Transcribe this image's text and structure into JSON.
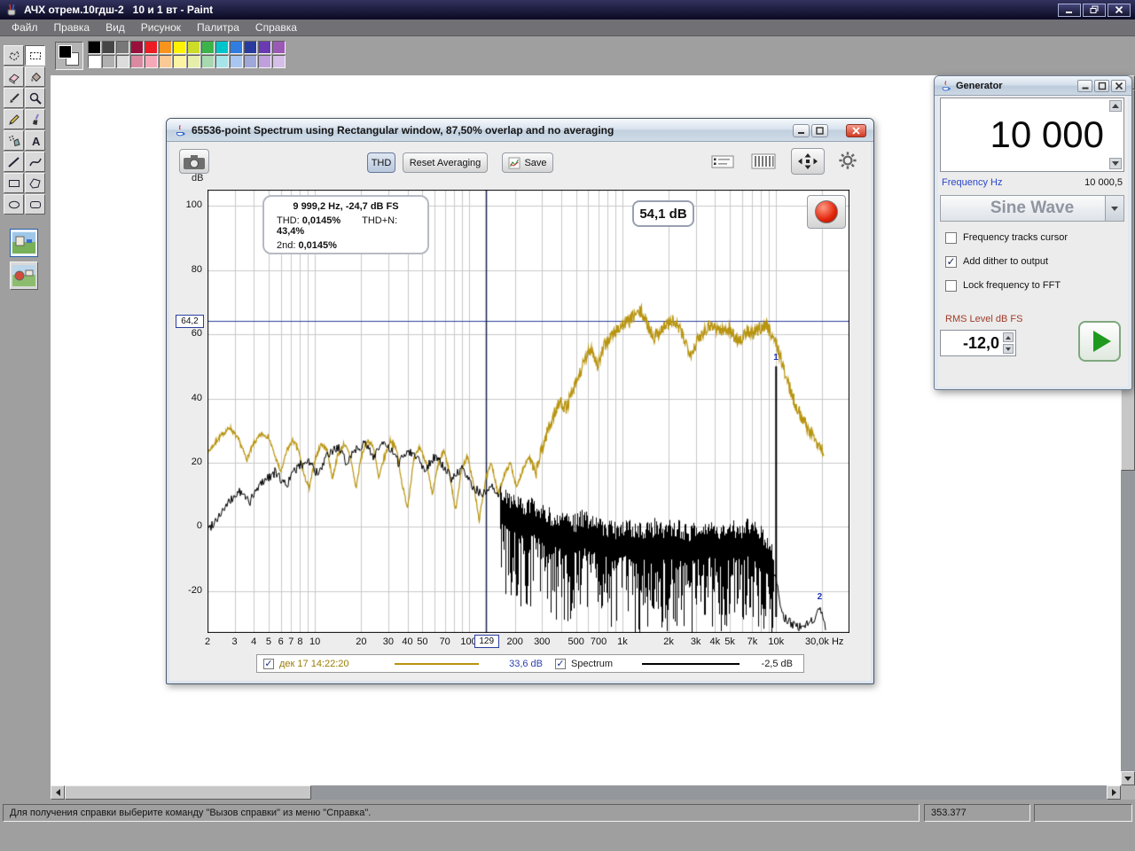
{
  "paint": {
    "title": "АЧХ отрем.10гдш-2   10 и 1 вт - Paint",
    "menu": [
      "Файл",
      "Правка",
      "Вид",
      "Рисунок",
      "Палитра",
      "Справка"
    ],
    "tools": [
      "free-select",
      "rect-select",
      "eraser",
      "fill",
      "color-picker",
      "magnifier",
      "pencil",
      "brush",
      "airbrush",
      "text",
      "line",
      "curve",
      "rectangle",
      "polygon",
      "ellipse",
      "rounded-rectangle"
    ],
    "selected_tool": "rect-select",
    "palette_row1": [
      "#000000",
      "#464646",
      "#787878",
      "#98103c",
      "#ed1c24",
      "#f7941d",
      "#fff200",
      "#cddc29",
      "#3cb44a",
      "#00c4cc",
      "#2f7de0",
      "#2a3b9e",
      "#6a3ab2",
      "#9b59b6"
    ],
    "palette_row2": [
      "#ffffff",
      "#b0b0b0",
      "#dcdcdc",
      "#d98aa0",
      "#f5a9b8",
      "#fbc993",
      "#fdf4a3",
      "#e6eeaa",
      "#a8d8b0",
      "#a5e5ea",
      "#a9c6f0",
      "#9fa8d8",
      "#bfa0dd",
      "#d5bfe8"
    ],
    "status": {
      "help_text": "Для получения справки выберите команду \"Вызов справки\" из меню \"Справка\".",
      "coords": "353.377"
    }
  },
  "rta": {
    "title": "65536-point Spectrum using Rectangular window, 87,50% overlap and no averaging",
    "toolbar": {
      "thd_label": "THD",
      "reset_label": "Reset Averaging",
      "save_label": "Save"
    },
    "db_label": "dB",
    "cursor_readout": {
      "line1": "9 999,2 Hz, -24,7 dB FS",
      "thd_label": "THD:",
      "thd": "0,0145%",
      "thdn_label": "THD+N:",
      "thdn": "43,4%",
      "h2_label": "2nd:",
      "h2": "0,0145%"
    },
    "level_display": "54,1 dB",
    "cursor_x": "129",
    "cursor_y": "64,2",
    "marker1": "1",
    "marker2": "2",
    "legend": [
      {
        "checked": true,
        "label": "дек 17 14:22:20",
        "value": "33,6 dB",
        "color": "#b8940f",
        "label_color": "#9a7d00",
        "value_color": "#2a3fb0"
      },
      {
        "checked": true,
        "label": "Spectrum",
        "value": "-2,5 dB",
        "color": "#000000",
        "label_color": "#1a1a1a",
        "value_color": "#1a1a1a"
      }
    ]
  },
  "generator": {
    "title": "Generator",
    "frequency_display": "10 000",
    "frequency_label": "Frequency Hz",
    "frequency_exact": "10 000,5",
    "waveform": "Sine Wave",
    "options": [
      {
        "label": "Frequency tracks cursor",
        "checked": false
      },
      {
        "label": "Add dither to output",
        "checked": true
      },
      {
        "label": "Lock frequency to FFT",
        "checked": false
      }
    ],
    "rms_label": "RMS Level dB FS",
    "rms_value": "-12,0"
  },
  "accents": {
    "frequency_label": "#2a46c8",
    "rms_label": "#a03c28",
    "cursor_line": "#2a3f9f",
    "marker": "#2233bb"
  },
  "chart_data": {
    "type": "line",
    "title": "65536-point Spectrum using Rectangular window, 87,50% overlap and no averaging",
    "xlabel": "Hz",
    "ylabel": "dB",
    "x_scale": "log",
    "x_range": [
      2,
      30000
    ],
    "y_range": [
      -33,
      105
    ],
    "grid": true,
    "y_ticks": [
      100,
      80,
      60,
      40,
      20,
      0,
      -20
    ],
    "x_tick_values": [
      2,
      3,
      4,
      5,
      6,
      7,
      8,
      10,
      20,
      30,
      40,
      50,
      70,
      100,
      200,
      300,
      500,
      700,
      1000,
      2000,
      3000,
      4000,
      5000,
      7000,
      10000
    ],
    "x_tick_labels": [
      "2",
      "3",
      "4",
      "5",
      "6",
      "7",
      "8",
      "10",
      "20",
      "30",
      "40",
      "50",
      "70",
      "100",
      "200",
      "300",
      "500",
      "700",
      "1k",
      "2k",
      "3k",
      "4k",
      "5k",
      "7k",
      "10k"
    ],
    "x_end_label": "30,0k Hz",
    "cursor": {
      "x": 129,
      "y": 64.2
    },
    "series": [
      {
        "name": "дек 17 14:22:20",
        "color": "#b8940f",
        "cursor_value_db": 33.6,
        "f_max": 20500,
        "points": [
          [
            2,
            23
          ],
          [
            2.4,
            28
          ],
          [
            2.8,
            31
          ],
          [
            3.2,
            27
          ],
          [
            3.6,
            21
          ],
          [
            4,
            26
          ],
          [
            4.5,
            29
          ],
          [
            5,
            28
          ],
          [
            5.5,
            22
          ],
          [
            6,
            17
          ],
          [
            6.6,
            24
          ],
          [
            7.2,
            27
          ],
          [
            7.8,
            24
          ],
          [
            8.5,
            16
          ],
          [
            9.2,
            12
          ],
          [
            10,
            21
          ],
          [
            11,
            26
          ],
          [
            12,
            24
          ],
          [
            13,
            15
          ],
          [
            14,
            22
          ],
          [
            15.5,
            26
          ],
          [
            17,
            22
          ],
          [
            18.5,
            12
          ],
          [
            20,
            22
          ],
          [
            22,
            27
          ],
          [
            24,
            25
          ],
          [
            26,
            15
          ],
          [
            28,
            21
          ],
          [
            31,
            27
          ],
          [
            34,
            24
          ],
          [
            37,
            13
          ],
          [
            40,
            6
          ],
          [
            44,
            21
          ],
          [
            48,
            25
          ],
          [
            53,
            20
          ],
          [
            58,
            10
          ],
          [
            63,
            19
          ],
          [
            69,
            24
          ],
          [
            75,
            17
          ],
          [
            82,
            5
          ],
          [
            90,
            18
          ],
          [
            98,
            22
          ],
          [
            107,
            14
          ],
          [
            117,
            2
          ],
          [
            129,
            15
          ],
          [
            141,
            20
          ],
          [
            155,
            10
          ],
          [
            170,
            16
          ],
          [
            187,
            20
          ],
          [
            205,
            12
          ],
          [
            225,
            18
          ],
          [
            247,
            22
          ],
          [
            271,
            16
          ],
          [
            298,
            24
          ],
          [
            327,
            30
          ],
          [
            359,
            35
          ],
          [
            394,
            39
          ],
          [
            433,
            37
          ],
          [
            475,
            42
          ],
          [
            522,
            47
          ],
          [
            573,
            52
          ],
          [
            629,
            56
          ],
          [
            690,
            50
          ],
          [
            758,
            56
          ],
          [
            832,
            59
          ],
          [
            913,
            61
          ],
          [
            1003,
            63
          ],
          [
            1101,
            64
          ],
          [
            1209,
            66
          ],
          [
            1327,
            67
          ],
          [
            1457,
            63
          ],
          [
            1600,
            59
          ],
          [
            1757,
            61
          ],
          [
            1929,
            63
          ],
          [
            2118,
            64
          ],
          [
            2325,
            62
          ],
          [
            2553,
            58
          ],
          [
            2803,
            54
          ],
          [
            3077,
            58
          ],
          [
            3378,
            61
          ],
          [
            3709,
            63
          ],
          [
            4072,
            62
          ],
          [
            4470,
            61
          ],
          [
            4908,
            62
          ],
          [
            5389,
            59
          ],
          [
            5916,
            58
          ],
          [
            6495,
            61
          ],
          [
            7131,
            60
          ],
          [
            7829,
            62
          ],
          [
            8595,
            63
          ],
          [
            9436,
            60
          ],
          [
            10360,
            55
          ],
          [
            11370,
            48
          ],
          [
            12490,
            42
          ],
          [
            13710,
            37
          ],
          [
            15050,
            33
          ],
          [
            16520,
            30
          ],
          [
            18140,
            27
          ],
          [
            19920,
            24
          ]
        ]
      },
      {
        "name": "Spectrum",
        "color": "#000000",
        "cursor_value_db": -2.5,
        "f_max": 21000,
        "dense_range": [
          160,
          9600
        ],
        "spike": {
          "freq": 10000,
          "db": 50
        },
        "marker2_at": {
          "freq": 19000,
          "db": -24
        },
        "points": [
          [
            2,
            -1
          ],
          [
            2.6,
            6
          ],
          [
            3.2,
            11
          ],
          [
            3.8,
            8
          ],
          [
            4.5,
            14
          ],
          [
            5.5,
            17
          ],
          [
            6.5,
            13
          ],
          [
            7.5,
            18
          ],
          [
            9,
            21
          ],
          [
            10.5,
            16
          ],
          [
            12,
            22
          ],
          [
            14,
            25
          ],
          [
            16,
            20
          ],
          [
            18,
            24
          ],
          [
            21,
            26
          ],
          [
            24,
            22
          ],
          [
            27,
            26
          ],
          [
            31,
            24
          ],
          [
            35,
            20
          ],
          [
            40,
            24
          ],
          [
            46,
            22
          ],
          [
            52,
            18
          ],
          [
            60,
            22
          ],
          [
            68,
            19
          ],
          [
            78,
            15
          ],
          [
            90,
            18
          ],
          [
            105,
            13
          ],
          [
            122,
            10
          ],
          [
            142,
            12
          ],
          [
            165,
            8
          ],
          [
            192,
            6
          ],
          [
            225,
            4
          ],
          [
            262,
            5
          ],
          [
            305,
            2
          ],
          [
            356,
            1
          ],
          [
            415,
            0
          ],
          [
            484,
            -1
          ],
          [
            565,
            1
          ],
          [
            659,
            -1
          ],
          [
            769,
            -2
          ],
          [
            897,
            -3
          ],
          [
            1046,
            -2
          ],
          [
            1220,
            -4
          ],
          [
            1424,
            -3
          ],
          [
            1661,
            -2
          ],
          [
            1937,
            -3
          ],
          [
            2260,
            -2
          ],
          [
            2636,
            -4
          ],
          [
            3075,
            -3
          ],
          [
            3587,
            -2
          ],
          [
            4184,
            -3
          ],
          [
            4880,
            -2
          ],
          [
            5693,
            -3
          ],
          [
            6640,
            -2
          ],
          [
            7745,
            -4
          ],
          [
            8800,
            -7
          ],
          [
            9300,
            -10
          ],
          [
            9650,
            -14
          ],
          [
            10200,
            -18
          ],
          [
            10600,
            -24
          ],
          [
            11200,
            -28
          ],
          [
            12500,
            -30
          ],
          [
            14000,
            -31
          ],
          [
            16000,
            -30
          ],
          [
            18000,
            -28
          ],
          [
            19500,
            -26
          ],
          [
            20500,
            -31
          ]
        ]
      }
    ]
  }
}
